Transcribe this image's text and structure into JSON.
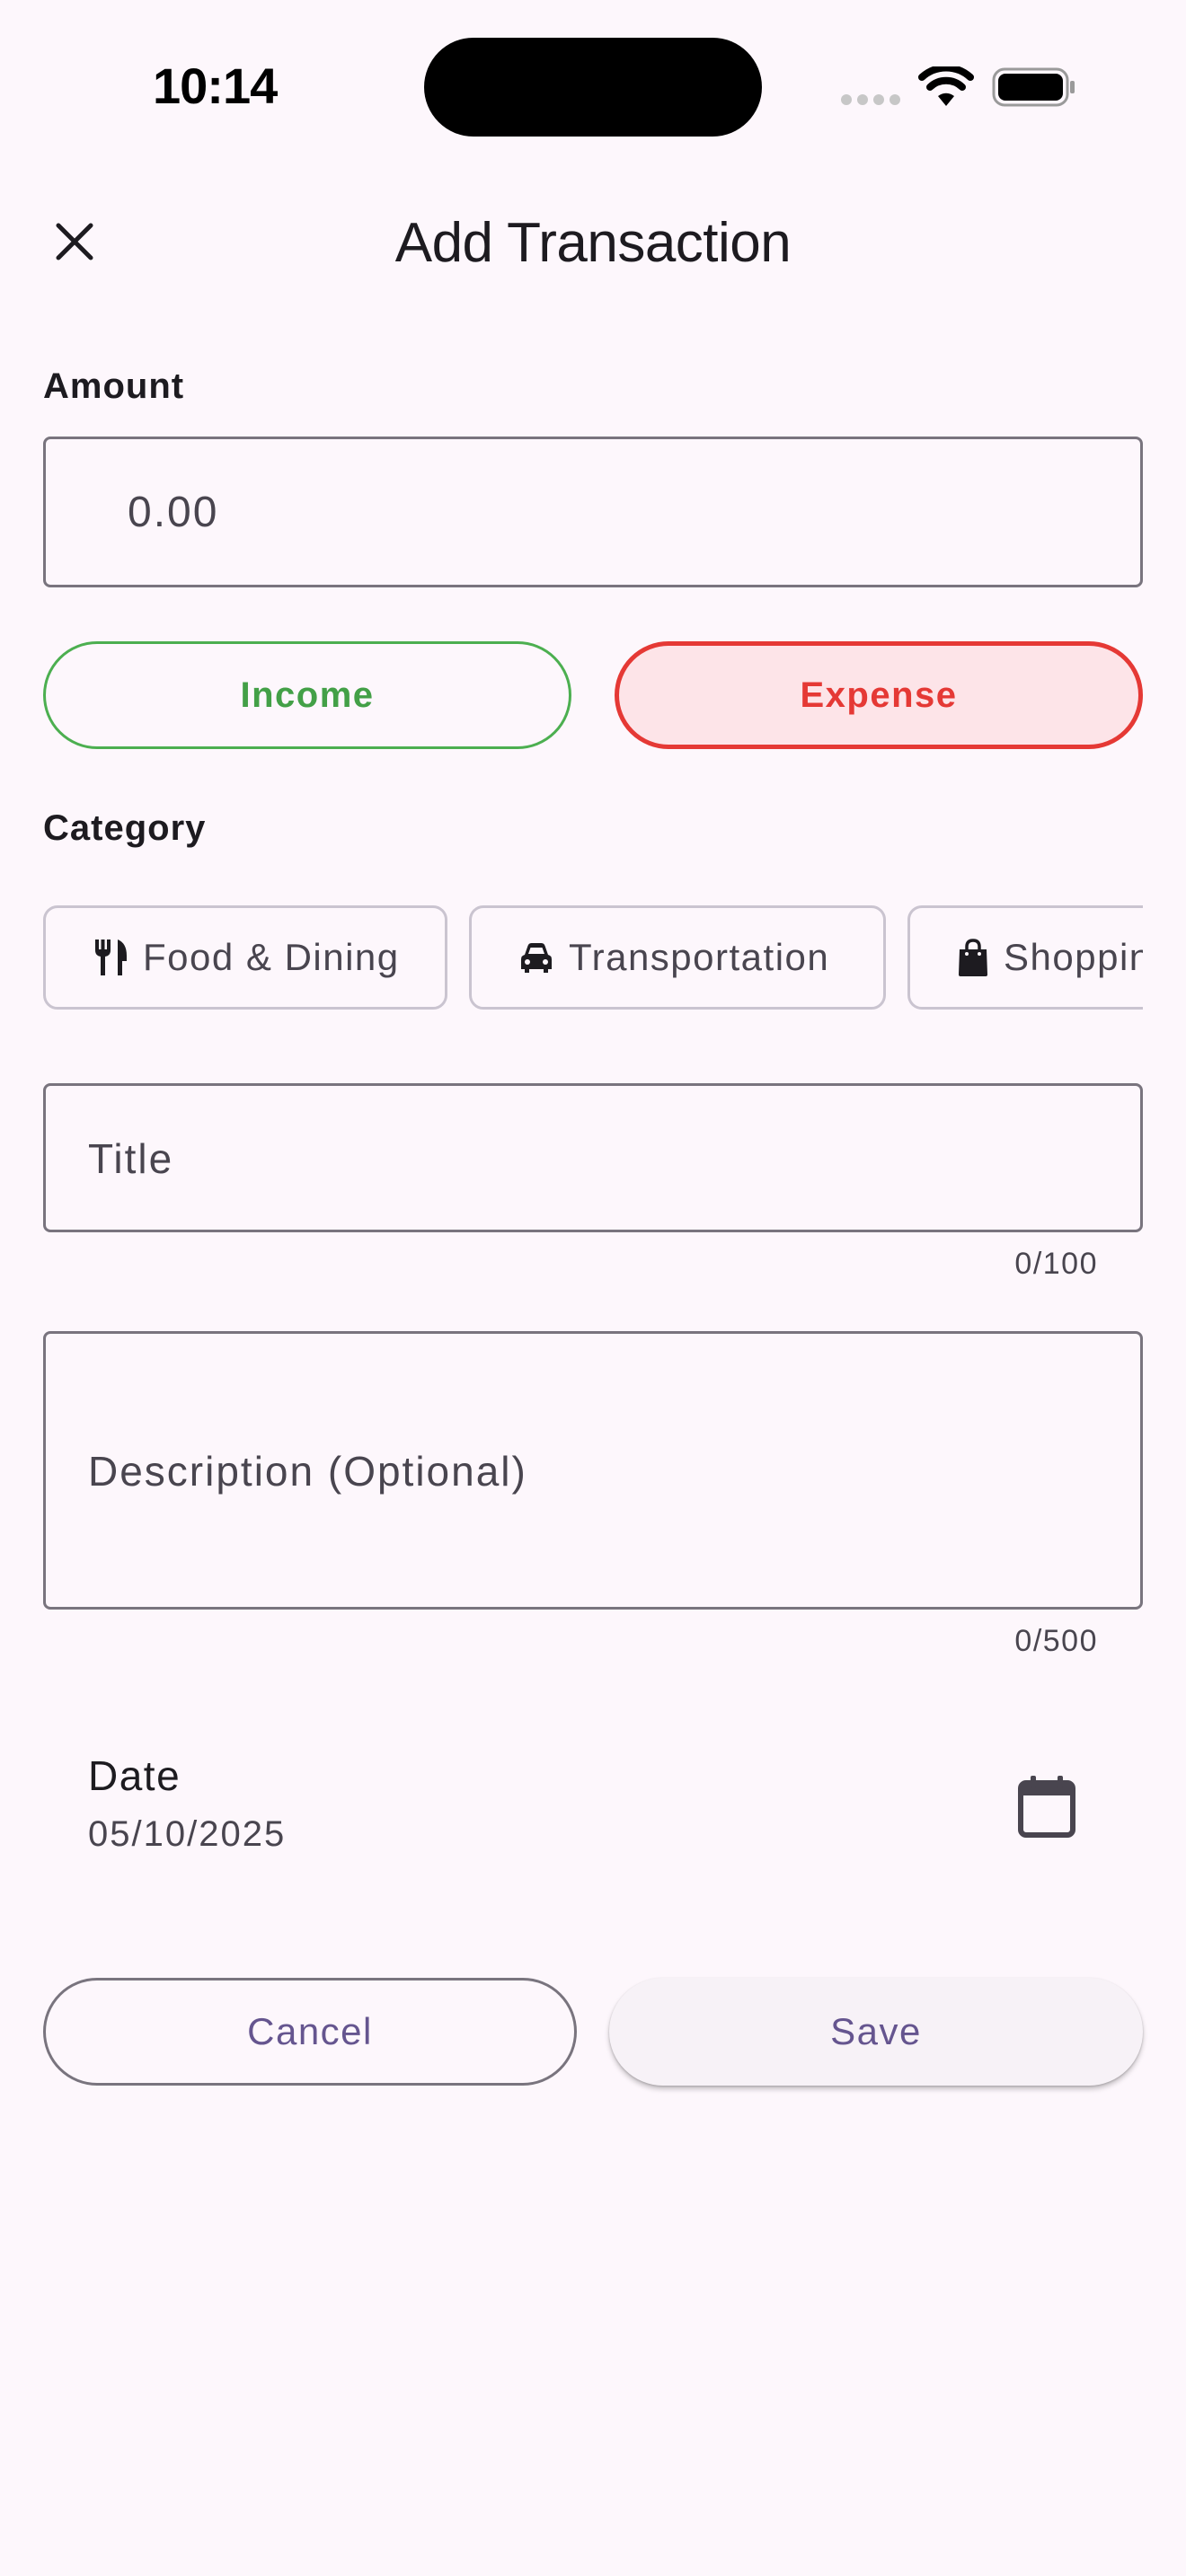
{
  "status_bar": {
    "time": "10:14"
  },
  "header": {
    "title": "Add Transaction",
    "close_icon": "close-icon"
  },
  "amount": {
    "label": "Amount",
    "placeholder": "0.00"
  },
  "transaction_type": {
    "income_label": "Income",
    "expense_label": "Expense",
    "selected": "Expense",
    "income_color": "#43a047",
    "expense_color": "#e53935"
  },
  "category": {
    "label": "Category",
    "chips": [
      {
        "label": "Food & Dining",
        "icon": "utensils-icon"
      },
      {
        "label": "Transportation",
        "icon": "car-icon"
      },
      {
        "label": "Shopping",
        "icon": "shopping-bag-icon"
      }
    ]
  },
  "title_field": {
    "placeholder": "Title",
    "counter": "0/100"
  },
  "description_field": {
    "placeholder": "Description (Optional)",
    "counter": "0/500"
  },
  "date": {
    "label": "Date",
    "value": "05/10/2025",
    "icon": "calendar-icon"
  },
  "actions": {
    "cancel_label": "Cancel",
    "save_label": "Save",
    "accent": "#65558f"
  }
}
